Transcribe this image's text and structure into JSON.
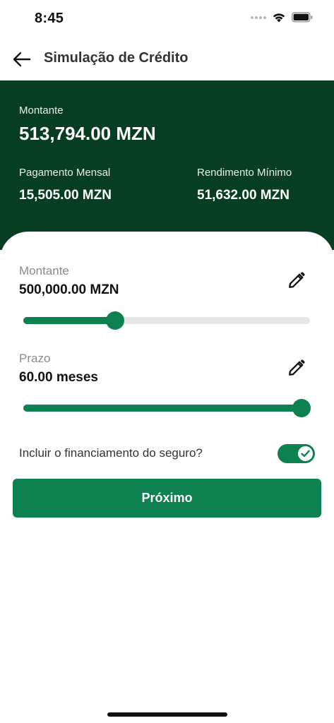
{
  "status_bar": {
    "time": "8:45"
  },
  "header": {
    "title": "Simulação de Crédito"
  },
  "summary": {
    "amount_label": "Montante",
    "amount_value": "513,794.00 MZN",
    "monthly_label": "Pagamento Mensal",
    "monthly_value": "15,505.00 MZN",
    "min_income_label": "Rendimento Mínimo",
    "min_income_value": "51,632.00 MZN"
  },
  "form": {
    "amount": {
      "label": "Montante",
      "value": "500,000.00 MZN",
      "slider_fraction": 0.32
    },
    "term": {
      "label": "Prazo",
      "value": "60.00 meses",
      "slider_fraction": 0.97
    },
    "insurance": {
      "label": "Incluir o financiamento do seguro?",
      "enabled": true
    },
    "next_label": "Próximo"
  },
  "colors": {
    "header_green": "#073d22",
    "accent_green": "#0e8150",
    "track_grey": "#e6e6e6"
  },
  "icons": [
    "back-arrow-icon",
    "pencil-icon",
    "check-icon",
    "wifi-icon",
    "battery-icon",
    "signal-icon"
  ]
}
